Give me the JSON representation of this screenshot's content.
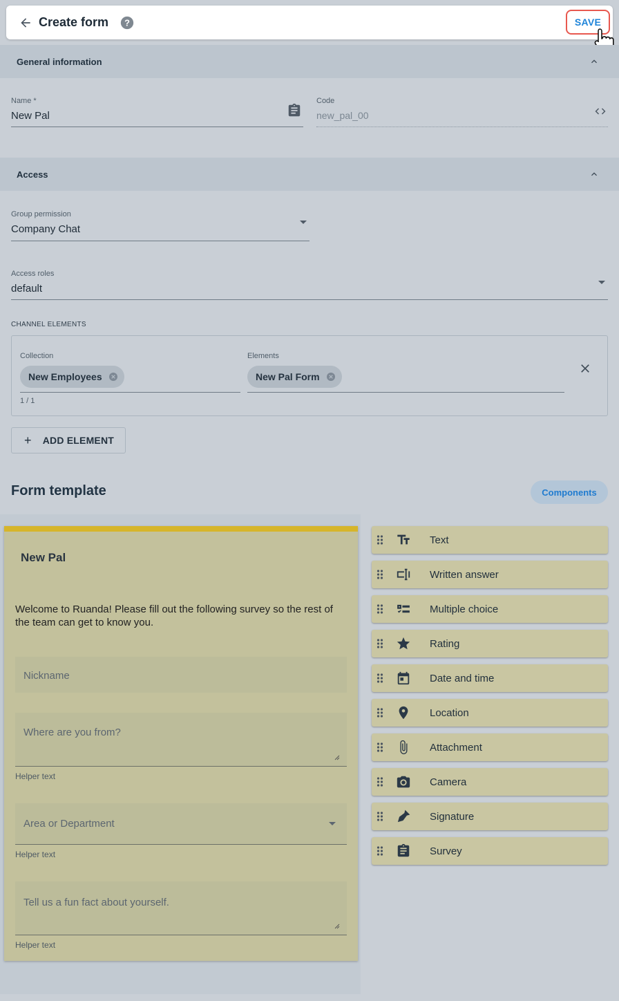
{
  "header": {
    "title": "Create form",
    "save_label": "SAVE"
  },
  "general": {
    "section_title": "General information",
    "name_label": "Name *",
    "name_value": "New Pal",
    "code_label": "Code",
    "code_value": "new_pal_00"
  },
  "access": {
    "section_title": "Access",
    "group_label": "Group permission",
    "group_value": "Company Chat",
    "roles_label": "Access roles",
    "roles_value": "default",
    "channel_heading": "CHANNEL ELEMENTS",
    "collection_label": "Collection",
    "collection_chip": "New Employees",
    "elements_label": "Elements",
    "elements_chip": "New Pal Form",
    "counter": "1 / 1",
    "add_element_label": "ADD ELEMENT"
  },
  "template": {
    "title": "Form template",
    "components_button": "Components",
    "form_title": "New Pal",
    "description": "Welcome to Ruanda! Please fill out the following survey so the rest of the team can get to know you.",
    "fields": {
      "nickname": "Nickname",
      "from": "Where are you from?",
      "area": "Area or Department",
      "funfact": "Tell us a fun fact about yourself.",
      "helper": "Helper text"
    }
  },
  "components": [
    {
      "label": "Text",
      "icon": "text-format-icon"
    },
    {
      "label": "Written answer",
      "icon": "text-field-icon"
    },
    {
      "label": "Multiple choice",
      "icon": "checklist-icon"
    },
    {
      "label": "Rating",
      "icon": "star-icon"
    },
    {
      "label": "Date and time",
      "icon": "calendar-icon"
    },
    {
      "label": "Location",
      "icon": "location-pin-icon"
    },
    {
      "label": "Attachment",
      "icon": "paperclip-icon"
    },
    {
      "label": "Camera",
      "icon": "camera-icon"
    },
    {
      "label": "Signature",
      "icon": "pen-icon"
    },
    {
      "label": "Survey",
      "icon": "clipboard-icon"
    }
  ],
  "colors": {
    "accent": "#1e84d9",
    "save_border": "#e8584f",
    "card_top": "#d6b52a",
    "card_bg": "#c3c19c"
  }
}
